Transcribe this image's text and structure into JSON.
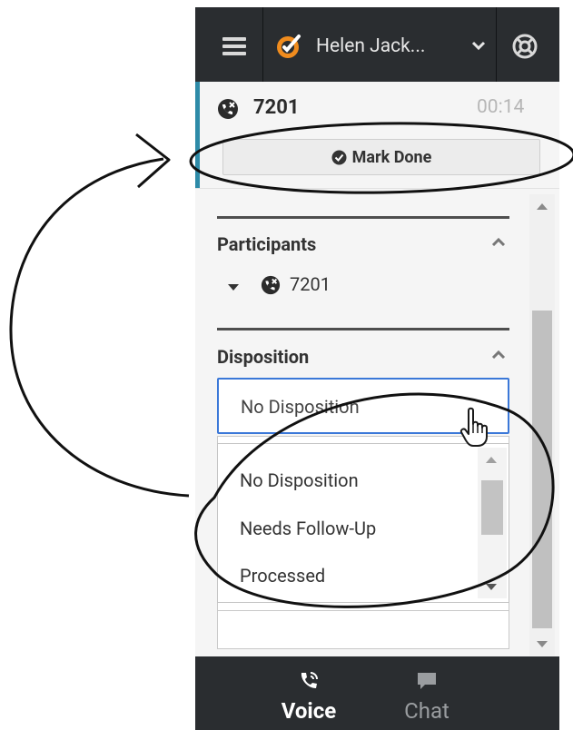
{
  "header": {
    "agent_name": "Helen Jack..."
  },
  "interaction": {
    "number": "7201",
    "timer": "00:14",
    "mark_done_label": "Mark Done"
  },
  "participants": {
    "title": "Participants",
    "items": [
      {
        "number": "7201"
      }
    ]
  },
  "disposition": {
    "title": "Disposition",
    "selected": "No Disposition",
    "options": [
      {
        "label": "No Disposition"
      },
      {
        "label": "Needs Follow-Up"
      },
      {
        "label": "Processed"
      }
    ]
  },
  "tabs": [
    {
      "label": "Voice",
      "active": true,
      "icon": "phone-icon"
    },
    {
      "label": "Chat",
      "active": false,
      "icon": "chat-icon"
    }
  ],
  "colors": {
    "bar_dark": "#2a2d30",
    "accent": "#2e8ba8",
    "agent_status": "#f08c1e",
    "select_border": "#3b78d8"
  }
}
